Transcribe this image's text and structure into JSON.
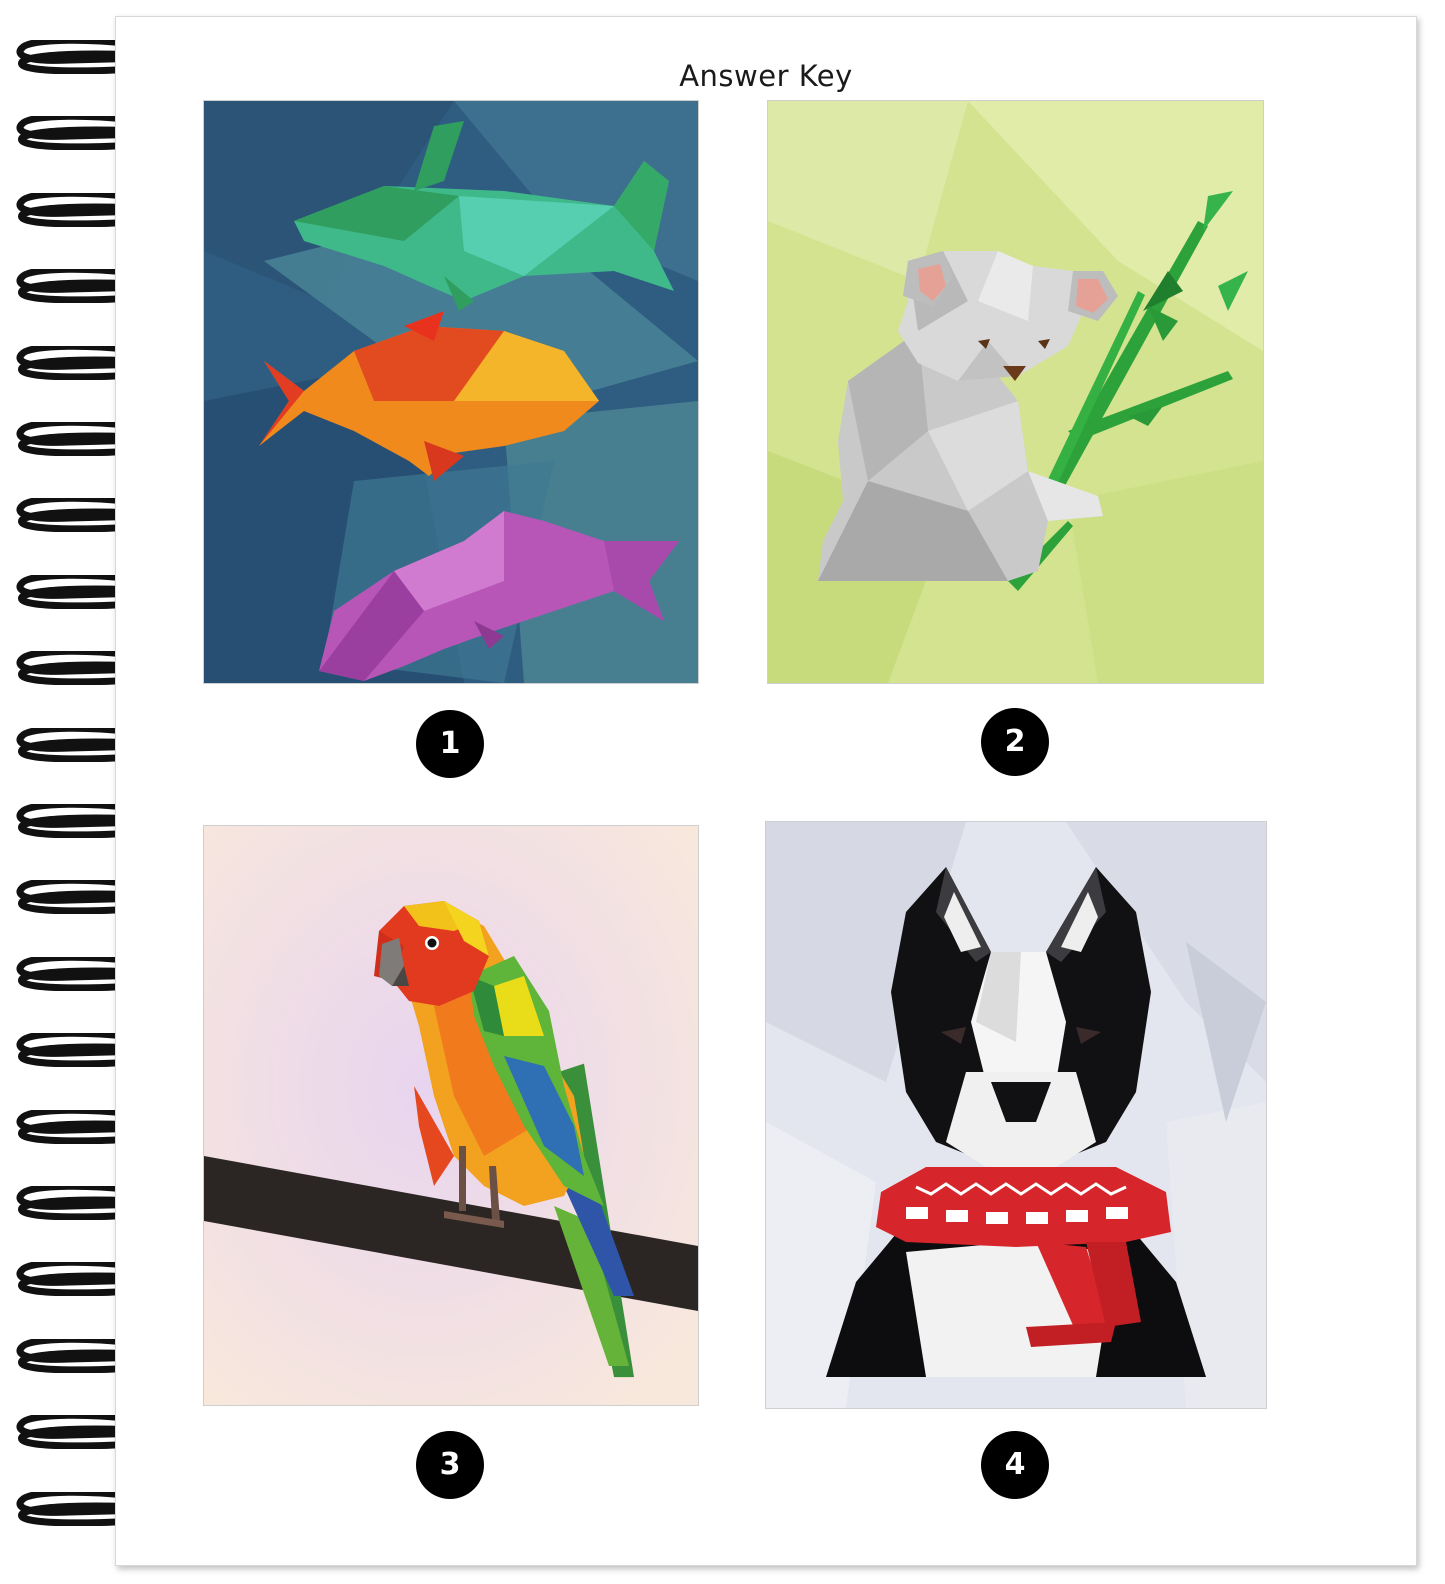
{
  "page": {
    "title": "Answer Key"
  },
  "answers": [
    {
      "number": "1",
      "subject": "fish-icon"
    },
    {
      "number": "2",
      "subject": "koala-icon"
    },
    {
      "number": "3",
      "subject": "parrot-icon"
    },
    {
      "number": "4",
      "subject": "dog-icon"
    }
  ],
  "colors": {
    "binding": "#111111",
    "badge": "#000000",
    "panel1_bg": "#2f5d82",
    "panel2_bg": "#d3e38f",
    "panel3_bg": "#f6e2dc",
    "panel4_bg": "#e3e6ee"
  }
}
